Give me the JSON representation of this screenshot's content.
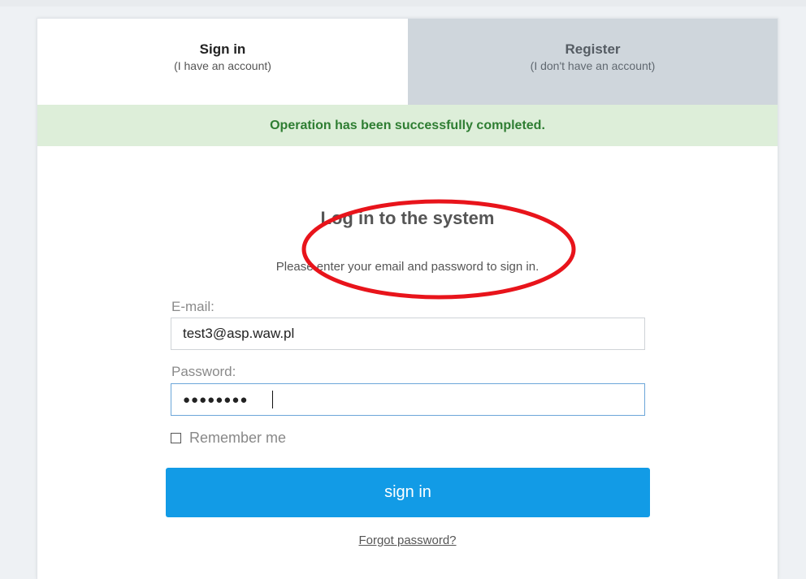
{
  "tabs": {
    "signin": {
      "title": "Sign in",
      "subtitle": "(I have an account)"
    },
    "register": {
      "title": "Register",
      "subtitle": "(I don't have an account)"
    }
  },
  "alert": {
    "message": "Operation has been successfully completed."
  },
  "form": {
    "heading": "Log in to the system",
    "subtitle": "Please enter your email and password to sign in.",
    "email_label": "E-mail:",
    "email_value": "test3@asp.waw.pl",
    "password_label": "Password:",
    "password_value": "●●●●●●●●",
    "remember_label": "Remember me",
    "remember_checked": false,
    "submit_label": "sign in",
    "forgot_label": "Forgot password?"
  },
  "colors": {
    "accent": "#129be6",
    "success_bg": "#ddeed9",
    "success_text": "#2e7d32",
    "annotation": "#e8141b"
  }
}
